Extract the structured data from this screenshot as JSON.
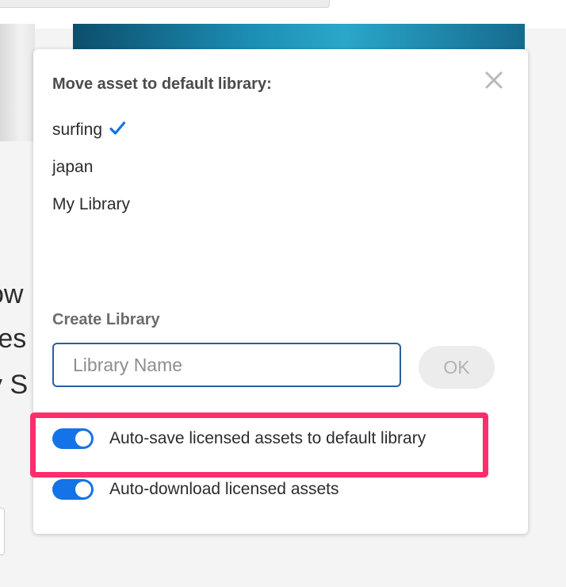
{
  "background": {
    "text_lines": [
      "ow",
      "res",
      "y S"
    ]
  },
  "popover": {
    "title": "Move asset to default library:",
    "close_icon": "close-x-icon",
    "libraries": [
      {
        "name": "surfing",
        "selected": true
      },
      {
        "name": "japan",
        "selected": false
      },
      {
        "name": "My Library",
        "selected": false
      }
    ],
    "check_icon": "checkmark-icon",
    "create_label": "Create Library",
    "library_name_input": {
      "value": "",
      "placeholder": "Library Name"
    },
    "ok_label": "OK",
    "toggles": [
      {
        "label": "Auto-save licensed assets to default library",
        "on": true
      },
      {
        "label": "Auto-download licensed assets",
        "on": true
      }
    ]
  },
  "colors": {
    "accent": "#1473e6",
    "highlight": "#ff2d6c",
    "input_border": "#2c5e9a"
  }
}
